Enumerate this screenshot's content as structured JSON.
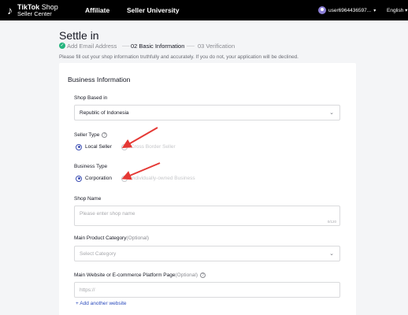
{
  "header": {
    "logo_line1": "TikTok",
    "logo_line1b": " Shop",
    "logo_line2": "Seller Center",
    "nav": [
      "Affiliate",
      "Seller University"
    ],
    "user_name": "user6964436597...",
    "language": "English"
  },
  "page": {
    "title": "Settle in",
    "steps": [
      {
        "label": "Add Email Address",
        "status": "done"
      },
      {
        "label": "02 Basic Information",
        "status": "active"
      },
      {
        "label": "03 Verification",
        "status": "pending"
      }
    ],
    "notice": "Please fill out your shop information truthfully and accurately. If you do not, your application will be declined."
  },
  "form": {
    "section_title": "Business Information",
    "shop_based_in": {
      "label": "Shop Based in",
      "value": "Republic of Indonesia"
    },
    "seller_type": {
      "label": "Seller Type",
      "options": [
        "Local Seller",
        "Cross Border Seller"
      ],
      "selected": "Local Seller"
    },
    "business_type": {
      "label": "Business Type",
      "options": [
        "Corporation",
        "Individually-owned Business"
      ],
      "selected": "Corporation"
    },
    "shop_name": {
      "label": "Shop Name",
      "placeholder": "Please enter shop name",
      "counter": "0/120"
    },
    "main_product_category": {
      "label": "Main Product Category",
      "optional": "(Optional)",
      "placeholder": "Select Category"
    },
    "website": {
      "label": "Main Website or E-commerce Platform Page",
      "optional": "(Optional)",
      "placeholder": "https://"
    },
    "add_website": "+ Add another website"
  },
  "colors": {
    "accent": "#3f51b5",
    "arrow": "#e53935",
    "done": "#24b47e"
  }
}
